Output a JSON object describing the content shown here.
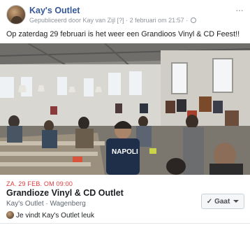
{
  "header": {
    "page_name": "Kay's Outlet",
    "published_prefix": "Gepubliceerd door Kay van Zijl",
    "marker": "[?]",
    "separator": "·",
    "date": "2 februari om 21:57",
    "date_sep": "·"
  },
  "post": {
    "text": "Op zaterdag 29 februari is het weer een Grandioos Vinyl & CD Feest!!"
  },
  "photo": {
    "shirt_text": "NAPOLI"
  },
  "event": {
    "date": "ZA. 29 FEB. OM 09:00",
    "title": "Grandioze Vinyl & CD Outlet",
    "host": "Kay's Outlet · Wagenberg",
    "likes": "Je vindt Kay's Outlet leuk",
    "going_button": "Gaat"
  },
  "colors": {
    "link": "#365899",
    "date_red": "#e0393e",
    "meta_gray": "#90949c"
  }
}
